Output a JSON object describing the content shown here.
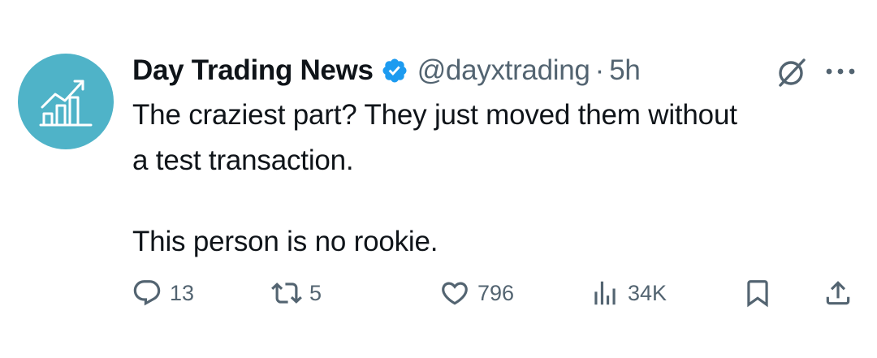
{
  "author": {
    "name": "Day Trading News",
    "handle": "@dayxtrading",
    "separator": "·",
    "time": "5h",
    "avatar_icon": "trend-chart-icon",
    "verified_icon": "verified-badge-icon"
  },
  "tweet": {
    "line1": "The craziest part? They just moved them without",
    "line2": "a test transaction.",
    "paragraph2": "This person is no rookie."
  },
  "actions": {
    "replies": "13",
    "reposts": "5",
    "likes": "796",
    "views": "34K"
  },
  "colors": {
    "avatar_bg": "#4fb3c8",
    "verified": "#1d9bf0",
    "text": "#0f1419",
    "secondary": "#536471"
  }
}
